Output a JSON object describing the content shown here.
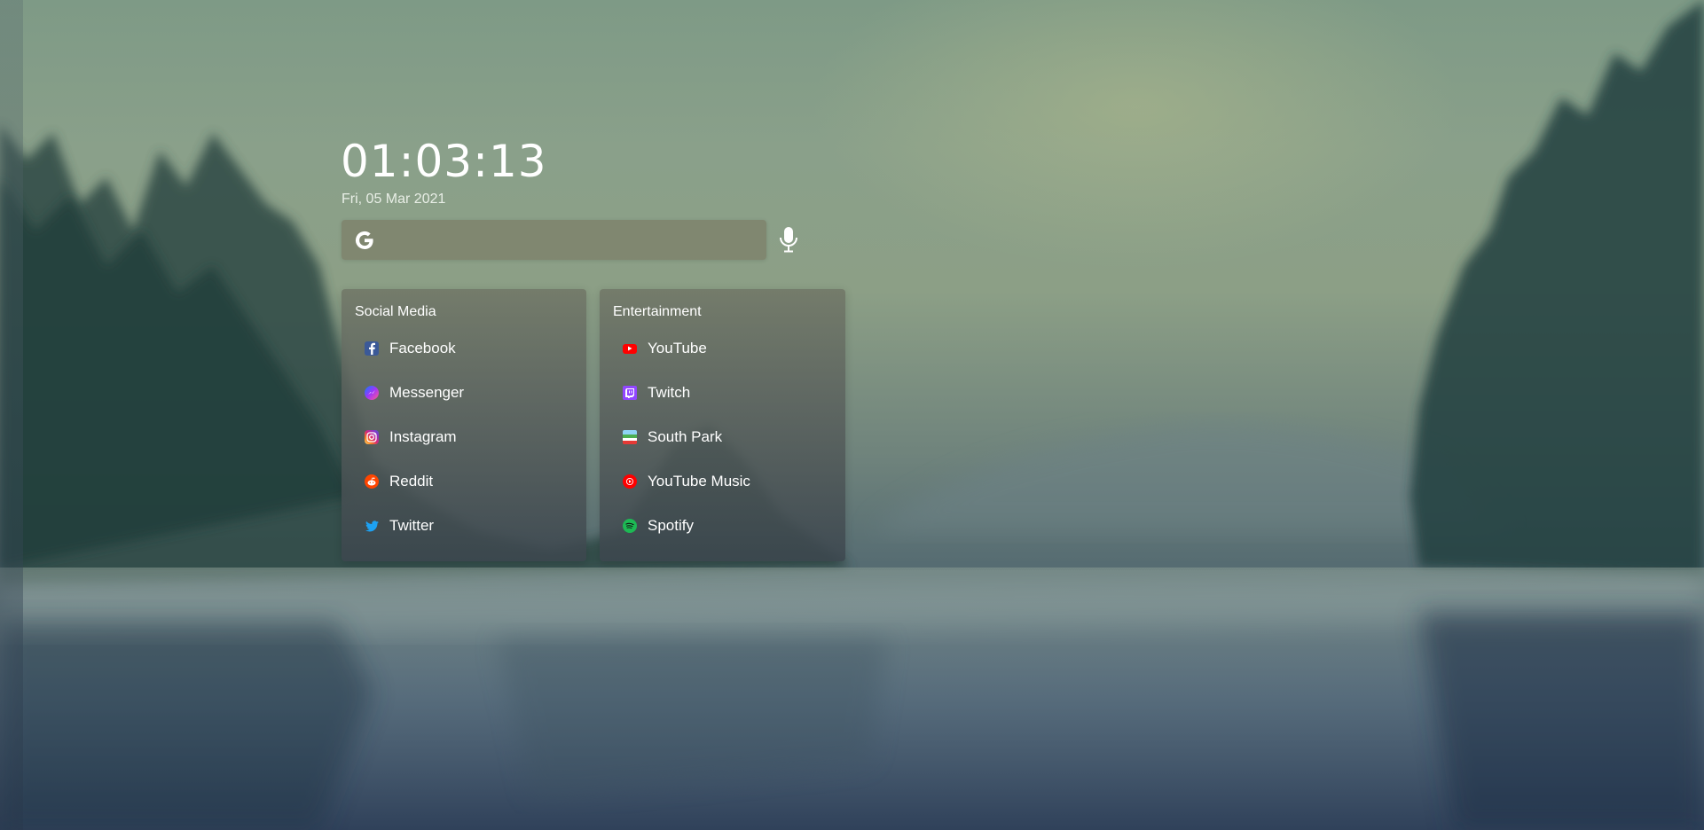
{
  "clock": {
    "time": "01:03:13"
  },
  "date": {
    "text": "Fri, 05 Mar 2021"
  },
  "search": {
    "value": "",
    "placeholder": ""
  },
  "groups": [
    {
      "title": "Social Media",
      "links": [
        {
          "label": "Facebook",
          "icon": "facebook-icon",
          "color": "#3b5998"
        },
        {
          "label": "Messenger",
          "icon": "messenger-icon",
          "color": "#7b4dff"
        },
        {
          "label": "Instagram",
          "icon": "instagram-icon",
          "color": "#e1306c"
        },
        {
          "label": "Reddit",
          "icon": "reddit-icon",
          "color": "#ff4500"
        },
        {
          "label": "Twitter",
          "icon": "twitter-icon",
          "color": "#1da1f2"
        }
      ]
    },
    {
      "title": "Entertainment",
      "links": [
        {
          "label": "YouTube",
          "icon": "youtube-icon",
          "color": "#ff0000"
        },
        {
          "label": "Twitch",
          "icon": "twitch-icon",
          "color": "#9146ff"
        },
        {
          "label": "South Park",
          "icon": "south-park-icon",
          "color": "#4caf50"
        },
        {
          "label": "YouTube Music",
          "icon": "youtube-music-icon",
          "color": "#ff0000"
        },
        {
          "label": "Spotify",
          "icon": "spotify-icon",
          "color": "#1db954"
        }
      ]
    }
  ]
}
